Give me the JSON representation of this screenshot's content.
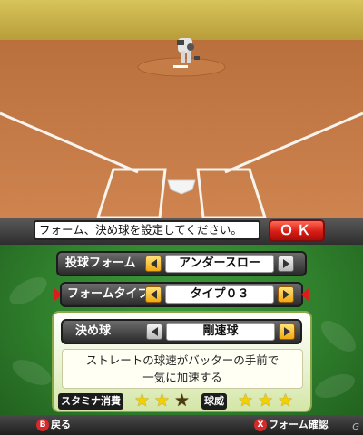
{
  "prompt": "フォーム、決め球を設定してください。",
  "ok_button": "ＯＫ",
  "form": {
    "label": "投球フォーム",
    "value": "アンダースロー"
  },
  "form_type": {
    "label": "フォームタイプ",
    "value": "タイプ０３"
  },
  "pitch": {
    "label": "決め球",
    "value": "剛速球",
    "description_line1": "ストレートの球速がバッターの手前で",
    "description_line2": "一気に加速する"
  },
  "stats": {
    "stamina_label": "スタミナ消費",
    "stamina_stars_filled": 2,
    "stamina_stars_total": 3,
    "power_label": "球威",
    "power_stars_filled": 3,
    "power_stars_total": 3
  },
  "bottom_bar": {
    "back_key": "B",
    "back_label": "戻る",
    "confirm_key": "X",
    "confirm_label": "フォーム確認"
  },
  "watermark": "G",
  "colors": {
    "grass": "#c8b54a",
    "dirt": "#c97a45",
    "menu_green": "#2f7f2c",
    "ok_red": "#d81c14",
    "star_yellow": "#f5d000",
    "star_dark": "#4a3a14",
    "cursor_red": "#e01a1a"
  },
  "icons": {
    "left_arrow": "chevron-left-icon",
    "right_arrow": "chevron-right-icon",
    "star": "star-icon",
    "b_button": "b-button-icon",
    "x_button": "x-button-icon"
  }
}
